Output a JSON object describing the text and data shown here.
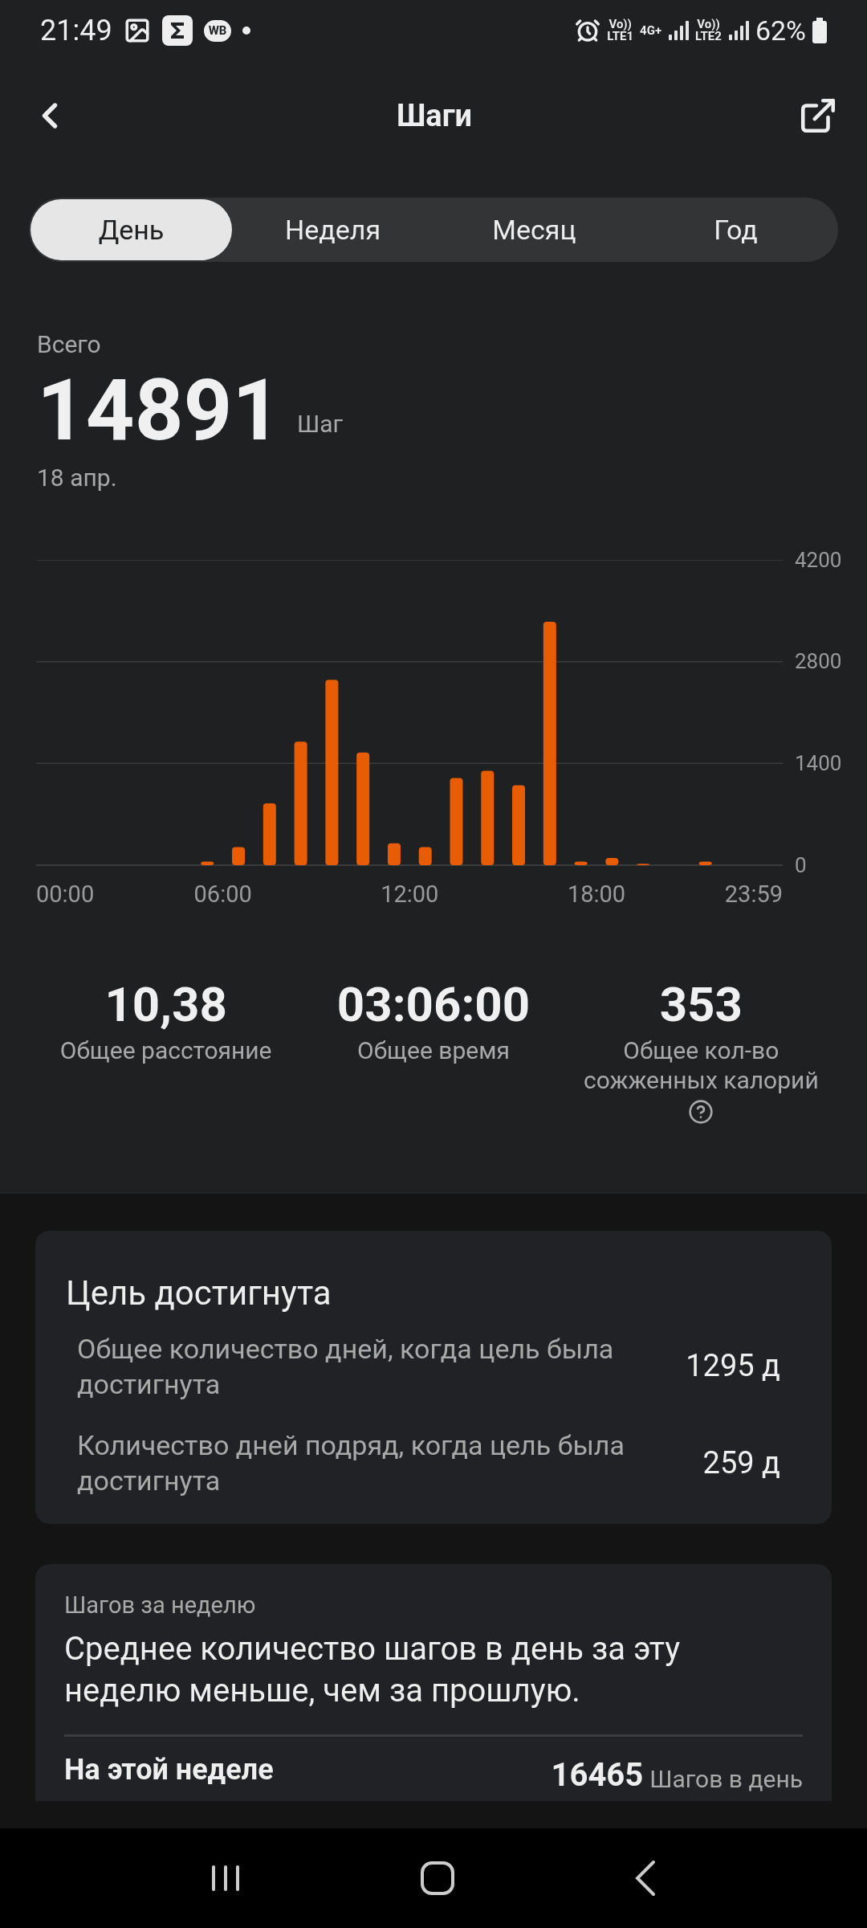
{
  "status_bar": {
    "time": "21:49",
    "badge": "WB",
    "sim1_top": "Vo))",
    "sim1_bottom": "LTE1",
    "network": "4G+",
    "sim2_top": "Vo))",
    "sim2_bottom": "LTE2",
    "battery": "62%"
  },
  "header": {
    "title": "Шаги"
  },
  "tabs": [
    {
      "label": "День",
      "selected": true
    },
    {
      "label": "Неделя",
      "selected": false
    },
    {
      "label": "Месяц",
      "selected": false
    },
    {
      "label": "Год",
      "selected": false
    }
  ],
  "summary": {
    "label": "Всего",
    "value": "14891",
    "unit": "Шаг",
    "date": "18 апр."
  },
  "chart_data": {
    "type": "bar",
    "x": [
      330,
      390,
      450,
      510,
      570,
      630,
      690,
      750,
      810,
      870,
      930,
      990,
      1050,
      1110,
      1170,
      1290
    ],
    "series": [
      {
        "color": "#e85d04",
        "values": [
          50,
          250,
          850,
          1700,
          2550,
          1550,
          300,
          250,
          1200,
          1300,
          1100,
          3350,
          50,
          100,
          20,
          50
        ]
      }
    ],
    "xlim": [
      0,
      1439
    ],
    "ylim": [
      0,
      4200
    ],
    "yticks": [
      0,
      1400,
      2800,
      4200
    ],
    "xticks": [
      {
        "value": 0,
        "label": "00:00"
      },
      {
        "value": 360,
        "label": "06:00"
      },
      {
        "value": 720,
        "label": "12:00"
      },
      {
        "value": 1080,
        "label": "18:00"
      },
      {
        "value": 1439,
        "label": "23:59"
      }
    ]
  },
  "stats": [
    {
      "value": "10,38",
      "label": "Общее расстояние",
      "help": false
    },
    {
      "value": "03:06:00",
      "label": "Общее время",
      "help": false
    },
    {
      "value": "353",
      "label": "Общее кол-во сожженных калорий",
      "help": true
    }
  ],
  "goal_card": {
    "title": "Цель достигнута",
    "rows": [
      {
        "label": "Общее количество дней, когда цель была достигнута",
        "value": "1295 д"
      },
      {
        "label": "Количество дней подряд, когда цель была достигнута",
        "value": "259 д"
      }
    ]
  },
  "week_card": {
    "caption": "Шагов за неделю",
    "message": "Среднее количество шагов в день за эту неделю меньше, чем за прошлую.",
    "row": {
      "label": "На этой неделе",
      "value": "16465",
      "unit": "Шагов в день"
    }
  }
}
